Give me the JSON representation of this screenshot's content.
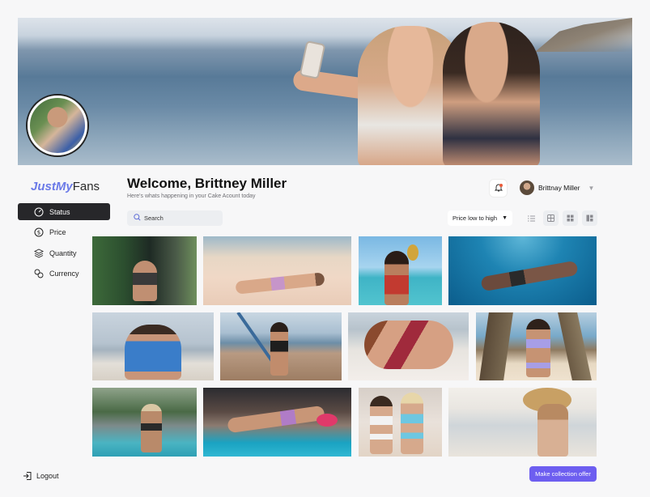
{
  "brand": {
    "logo_part1": "JustMy",
    "logo_part2": "Fans"
  },
  "header": {
    "welcome": "Welcome, Brittney Miller",
    "subtitle": "Here's whats happening in your Cake Acount today",
    "user_name": "Brittnay Miller"
  },
  "nav": {
    "items": [
      {
        "label": "Status",
        "icon": "gauge-icon"
      },
      {
        "label": "Price",
        "icon": "dollar-icon"
      },
      {
        "label": "Quantity",
        "icon": "layers-icon"
      },
      {
        "label": "Currency",
        "icon": "currency-exchange-icon"
      }
    ],
    "logout": "Logout"
  },
  "toolbar": {
    "search_placeholder": "Search",
    "sort_label": "Price low to high"
  },
  "cta": {
    "label": "Make collection offer"
  },
  "colors": {
    "accent": "#6d5ef0",
    "active_nav": "#27272a",
    "notification": "#e95a39"
  }
}
